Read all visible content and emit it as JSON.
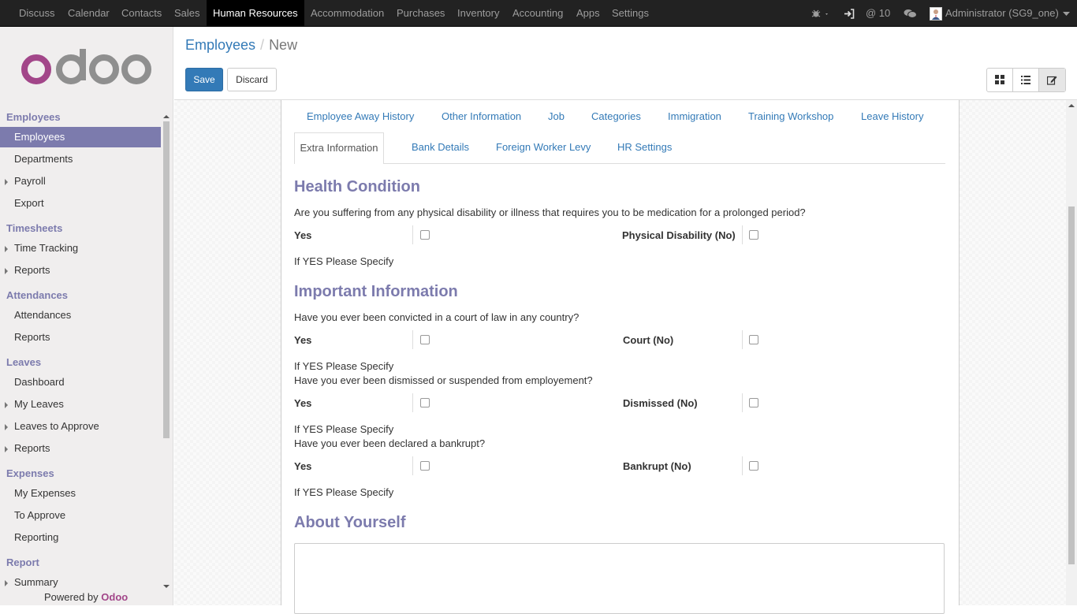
{
  "topbar": {
    "menu": [
      {
        "label": "Discuss"
      },
      {
        "label": "Calendar"
      },
      {
        "label": "Contacts"
      },
      {
        "label": "Sales"
      },
      {
        "label": "Human Resources"
      },
      {
        "label": "Accommodation"
      },
      {
        "label": "Purchases"
      },
      {
        "label": "Inventory"
      },
      {
        "label": "Accounting"
      },
      {
        "label": "Apps"
      },
      {
        "label": "Settings"
      }
    ],
    "active_index": 4,
    "notifications": "@ 10",
    "user": "Administrator (SG9_one)",
    "icons": [
      "bug-icon",
      "login-icon",
      "at-icon",
      "chat-icon",
      "avatar"
    ]
  },
  "sidebar": {
    "logo_text": "odoo",
    "sections": [
      {
        "title": "Employees",
        "items": [
          {
            "label": "Employees",
            "active": true
          },
          {
            "label": "Departments"
          },
          {
            "label": "Payroll",
            "expandable": true
          },
          {
            "label": "Export"
          }
        ]
      },
      {
        "title": "Timesheets",
        "items": [
          {
            "label": "Time Tracking",
            "expandable": true
          },
          {
            "label": "Reports",
            "expandable": true
          }
        ]
      },
      {
        "title": "Attendances",
        "items": [
          {
            "label": "Attendances"
          },
          {
            "label": "Reports"
          }
        ]
      },
      {
        "title": "Leaves",
        "items": [
          {
            "label": "Dashboard"
          },
          {
            "label": "My Leaves",
            "expandable": true
          },
          {
            "label": "Leaves to Approve",
            "expandable": true
          },
          {
            "label": "Reports",
            "expandable": true
          }
        ]
      },
      {
        "title": "Expenses",
        "items": [
          {
            "label": "My Expenses"
          },
          {
            "label": "To Approve"
          },
          {
            "label": "Reporting"
          }
        ]
      },
      {
        "title": "Report",
        "items": [
          {
            "label": "Summary",
            "expandable": true
          }
        ]
      }
    ],
    "powered_by": "Powered by",
    "powered_brand": "Odoo"
  },
  "control_panel": {
    "breadcrumb_parent": "Employees",
    "breadcrumb_sep": "/",
    "breadcrumb_current": "New",
    "save_label": "Save",
    "discard_label": "Discard",
    "views": [
      "kanban-icon",
      "list-icon",
      "form-icon"
    ]
  },
  "tabs": {
    "row1": [
      "Employee Away History",
      "Other Information",
      "Job",
      "Categories",
      "Immigration",
      "Training Workshop",
      "Leave History"
    ],
    "row2": [
      "Extra Information",
      "Bank Details",
      "Foreign Worker Levy",
      "HR Settings"
    ],
    "active": "Extra Information"
  },
  "form": {
    "health": {
      "title": "Health Condition",
      "question": "Are you suffering from any physical disability or illness that requires you to be medication for a prolonged period?",
      "yes_label": "Yes",
      "no_label": "Physical Disability (No)",
      "specify": "If YES Please Specify"
    },
    "important": {
      "title": "Important Information",
      "court_question": "Have you ever been convicted in a court of law in any country?",
      "court_yes": "Yes",
      "court_no": "Court (No)",
      "court_specify": "If YES Please Specify",
      "dismissed_question": "Have you ever been dismissed or suspended from employement?",
      "dismissed_yes": "Yes",
      "dismissed_no": "Dismissed (No)",
      "dismissed_specify": "If YES Please Specify",
      "bankrupt_question": "Have you ever been declared a bankrupt?",
      "bankrupt_yes": "Yes",
      "bankrupt_no": "Bankrupt (No)",
      "bankrupt_specify": "If YES Please Specify"
    },
    "about": {
      "title": "About Yourself",
      "value": ""
    }
  },
  "colors": {
    "accent": "#7c7bad",
    "link": "#337ab7",
    "primary": "#337ab7",
    "topbar": "#222222",
    "brand": "#a24689"
  }
}
